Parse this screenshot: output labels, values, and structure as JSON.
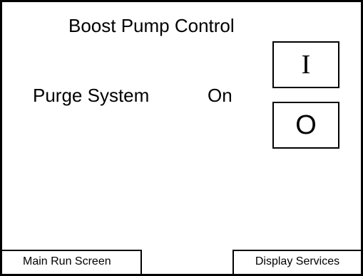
{
  "screen": {
    "title": "Boost Pump Control"
  },
  "status": {
    "label": "Purge System",
    "value": "On"
  },
  "controls": {
    "on_label": "I",
    "off_label": "O"
  },
  "nav": {
    "left_label": "Main Run Screen",
    "right_label": "Display Services"
  }
}
